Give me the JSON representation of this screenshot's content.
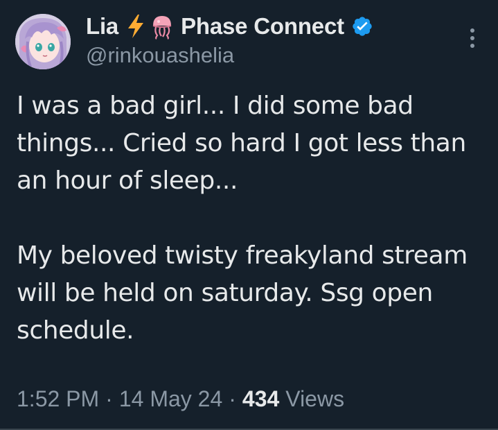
{
  "author": {
    "display_name": "Lia",
    "affiliation": "Phase Connect",
    "handle": "@rinkouashelia",
    "verified": true,
    "name_emojis": [
      "lightning-emoji",
      "jellyfish-emoji"
    ],
    "avatar_icon": "anime-girl-avatar"
  },
  "tweet": {
    "paragraphs": [
      "I was a bad girl... I did some bad things... Cried so hard I got less than an hour of sleep...",
      "My beloved twisty freakyland stream will be held on saturday. Ssg open schedule."
    ]
  },
  "meta": {
    "time": "1:52 PM",
    "separator": "·",
    "date": "14 May 24",
    "views_count": "434",
    "views_label": "Views"
  },
  "colors": {
    "background": "#15202b",
    "primary_text": "#e7e9ea",
    "secondary_text": "#8b98a5",
    "verified_blue": "#1d9bf0",
    "divider": "#38444d"
  },
  "icons": {
    "more": "more-vertical-icon",
    "verified": "verified-badge-icon"
  }
}
